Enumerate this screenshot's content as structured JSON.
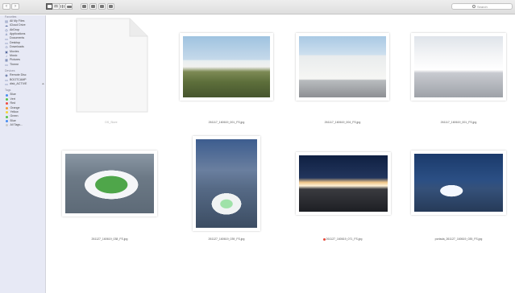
{
  "toolbar": {
    "back_icon": "chevron-left-icon",
    "forward_icon": "chevron-right-icon",
    "search_placeholder": "Search"
  },
  "sidebar": {
    "favorites_header": "Favorites",
    "favorites": [
      {
        "label": "All My Files",
        "icon": "all-files-icon"
      },
      {
        "label": "iCloud Drive",
        "icon": "cloud-icon"
      },
      {
        "label": "AirDrop",
        "icon": "airdrop-icon"
      },
      {
        "label": "Applications",
        "icon": "applications-icon"
      },
      {
        "label": "Documents",
        "icon": "documents-icon"
      },
      {
        "label": "Desktop",
        "icon": "desktop-icon"
      },
      {
        "label": "Downloads",
        "icon": "downloads-icon"
      },
      {
        "label": "Movies",
        "icon": "movies-icon"
      },
      {
        "label": "Music",
        "icon": "music-icon"
      },
      {
        "label": "Pictures",
        "icon": "pictures-icon"
      },
      {
        "label": "Theme",
        "icon": "folder-icon"
      }
    ],
    "devices_header": "Devices",
    "devices": [
      {
        "label": "Remote Disc",
        "icon": "disc-icon"
      },
      {
        "label": "BOOTCAMP",
        "icon": "drive-icon"
      },
      {
        "label": "disk_ACTIVE",
        "icon": "drive-icon"
      }
    ],
    "tags_header": "Tags",
    "tags": [
      {
        "label": "Blue",
        "color": "#4a8ef0"
      },
      {
        "label": "Vert",
        "color": "#55c24a"
      },
      {
        "label": "Red",
        "color": "#ee4a42"
      },
      {
        "label": "Orange",
        "color": "#f29a31"
      },
      {
        "label": "Yellow",
        "color": "#f3d23a"
      },
      {
        "label": "Green",
        "color": "#55c24a"
      },
      {
        "label": "Blue",
        "color": "#4a8ef0"
      },
      {
        "label": "All Tags...",
        "color": "#c9c9c9"
      }
    ]
  },
  "files": [
    {
      "name": "DS_Store",
      "kind": "document"
    },
    {
      "name": "261117_160619_001_FS.jpg",
      "kind": "image"
    },
    {
      "name": "261117_160619_004_FS.jpg",
      "kind": "image"
    },
    {
      "name": "261117_160619_001_FS.jpg",
      "kind": "image"
    },
    {
      "name": "261127_160619_038_FS.jpg",
      "kind": "image"
    },
    {
      "name": "261127_160619_039_FS.jpg",
      "kind": "image"
    },
    {
      "name": "261127_160619_071_FS.jpg",
      "kind": "image",
      "tag_color": "#e84a3c"
    },
    {
      "name": "portada_261127_160619_035_FS.jpg",
      "kind": "image"
    }
  ]
}
